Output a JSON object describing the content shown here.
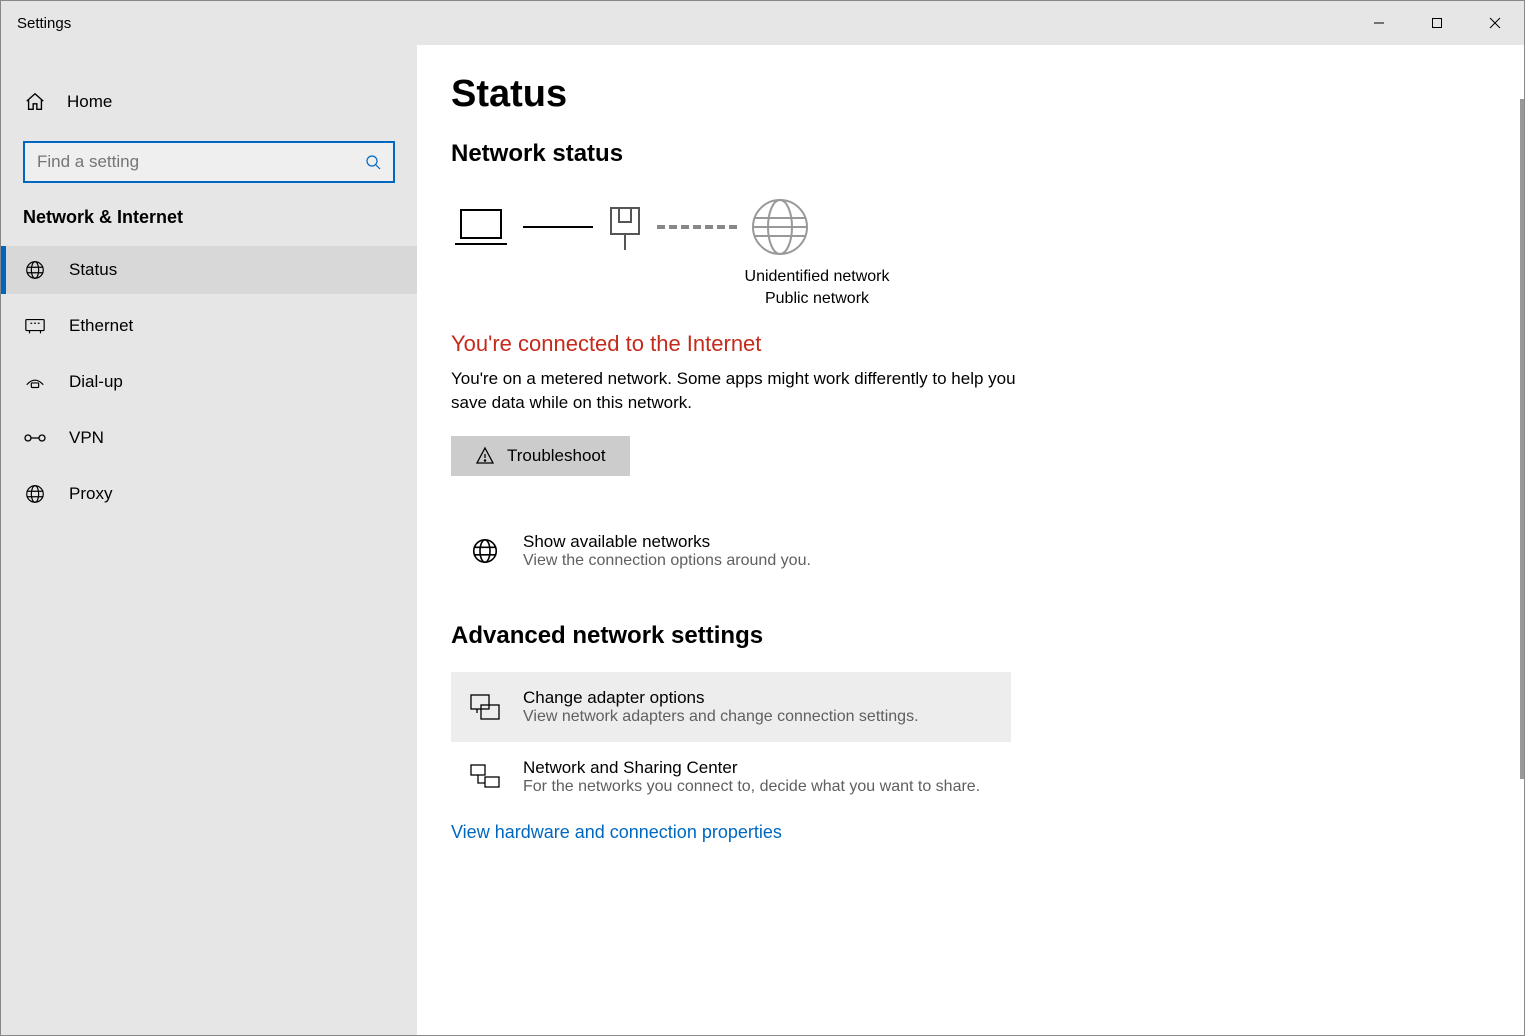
{
  "window": {
    "title": "Settings"
  },
  "sidebar": {
    "home_label": "Home",
    "search_placeholder": "Find a setting",
    "section": "Network & Internet",
    "items": [
      {
        "label": "Status"
      },
      {
        "label": "Ethernet"
      },
      {
        "label": "Dial-up"
      },
      {
        "label": "VPN"
      },
      {
        "label": "Proxy"
      }
    ]
  },
  "main": {
    "page_title": "Status",
    "sub_heading": "Network status",
    "diagram": {
      "line1": "Unidentified network",
      "line2": "Public network"
    },
    "error_heading": "You're connected to the Internet",
    "error_desc": "You're on a metered network. Some apps might work differently to help you save data while on this network.",
    "troubleshoot_label": "Troubleshoot",
    "available_title": "Show available networks",
    "available_sub": "View the connection options around you.",
    "section2": "Advanced network settings",
    "adapter_title": "Change adapter options",
    "adapter_sub": "View network adapters and change connection settings.",
    "sharing_title": "Network and Sharing Center",
    "sharing_sub": "For the networks you connect to, decide what you want to share.",
    "link": "View hardware and connection properties"
  }
}
